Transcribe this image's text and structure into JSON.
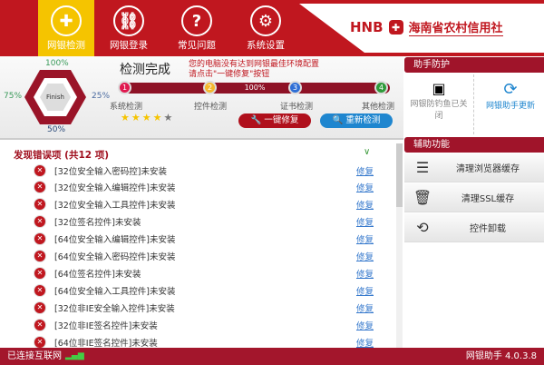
{
  "nav": {
    "items": [
      {
        "label": "网银检测",
        "icon": "shield-icon",
        "active": true
      },
      {
        "label": "网银登录",
        "icon": "link-icon"
      },
      {
        "label": "常见问题",
        "icon": "question-icon"
      },
      {
        "label": "系统设置",
        "icon": "gear-icon"
      }
    ]
  },
  "brand": {
    "abbr": "HNB",
    "name": "海南省农村信用社"
  },
  "status": {
    "p100": "100%",
    "p75": "75%",
    "p25": "25%",
    "p50": "50%",
    "center": "Finish",
    "title": "检测完成",
    "msg1": "您的电脑没有达到网银最佳环境配置",
    "msg2": "请点击\"一键修复\"按钮",
    "progress": "100%",
    "rating": 4,
    "rating_max": 5
  },
  "steps": [
    {
      "n": "1",
      "label": "系统检测",
      "color": "#e0194f"
    },
    {
      "n": "2",
      "label": "控件检测",
      "color": "#f5b82e"
    },
    {
      "n": "3",
      "label": "证书检测",
      "color": "#2f6fd6"
    },
    {
      "n": "4",
      "label": "其他检测",
      "color": "#2f9a3a"
    }
  ],
  "actions": {
    "fix_all": "一键修复",
    "recheck": "重新检测"
  },
  "list": {
    "title": "发现错误项 (共12 项)",
    "fix_label": "修复",
    "items": [
      "[32位安全输入密码控]未安装",
      "[32位安全输入编辑控件]未安装",
      "[32位安全输入工具控件]未安装",
      "[32位签名控件]未安装",
      "[64位安全输入编辑控件]未安装",
      "[64位安全输入密码控件]未安装",
      "[64位签名控件]未安装",
      "[64位安全输入工具控件]未安装",
      "[32位非IE安全输入控件]未安装",
      "[32位非IE签名控件]未安装",
      "[64位非IE签名控件]未安装"
    ]
  },
  "side": {
    "protect_title": "助手防护",
    "anti_phish": "网银防钓鱼已关闭",
    "update": "网银助手更新",
    "aux_title": "辅助功能",
    "tools": [
      "清理浏览器缓存",
      "清理SSL缓存",
      "控件卸载"
    ]
  },
  "footer": {
    "status": "已连接互联网",
    "version": "网银助手 4.0.3.8"
  }
}
